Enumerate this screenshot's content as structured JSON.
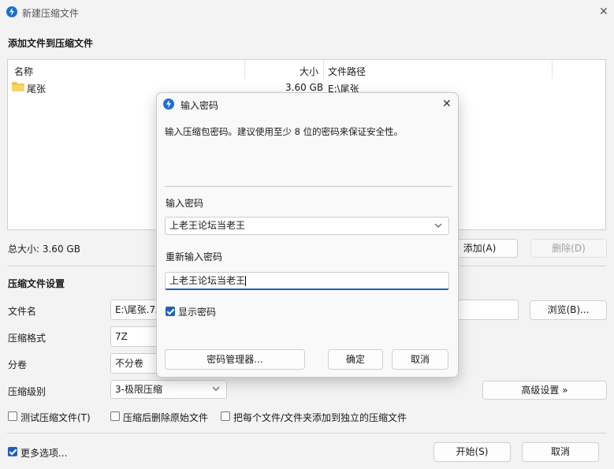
{
  "window": {
    "title": "新建压缩文件",
    "close_glyph": "✕"
  },
  "files_section": {
    "heading": "添加文件到压缩文件",
    "columns": [
      "名称",
      "大小",
      "文件路径"
    ],
    "rows": [
      {
        "name": "尾张",
        "size": "3.60 GB",
        "path": "E:\\尾张"
      }
    ],
    "total": "总大小: 3.60 GB",
    "add_button": "添加(A)",
    "delete_button": "删除(D)"
  },
  "settings": {
    "heading": "压缩文件设置",
    "filename_label": "文件名",
    "filename_value": "E:\\尾张.7z",
    "browse_button": "浏览(B)...",
    "format_label": "压缩格式",
    "format_value": "7Z",
    "split_label": "分卷",
    "split_value": "不分卷",
    "level_label": "压缩级别",
    "level_value": "3-极限压缩",
    "advanced_button": "高级设置 »",
    "test_option": "测试压缩文件(T)",
    "delete_after_option": "压缩后删除原始文件",
    "separate_option": "把每个文件/文件夹添加到独立的压缩文件",
    "more_options": "更多选项...",
    "start_button": "开始(S)",
    "cancel_button": "取消"
  },
  "dialog": {
    "title": "输入密码",
    "instruction": "输入压缩包密码。建议使用至少 8 位的密码来保证安全性。",
    "password_label": "输入密码",
    "password_value": "上老王论坛当老王",
    "confirm_label": "重新输入密码",
    "confirm_value": "上老王论坛当老王",
    "show_password": "显示密码",
    "manager_button": "密码管理器...",
    "ok_button": "确定",
    "cancel_button": "取消",
    "close_glyph": "✕"
  },
  "colors": {
    "accent": "#1f5fbf",
    "background": "#f3f3f3",
    "dialog_bg": "#f9f9f9"
  }
}
